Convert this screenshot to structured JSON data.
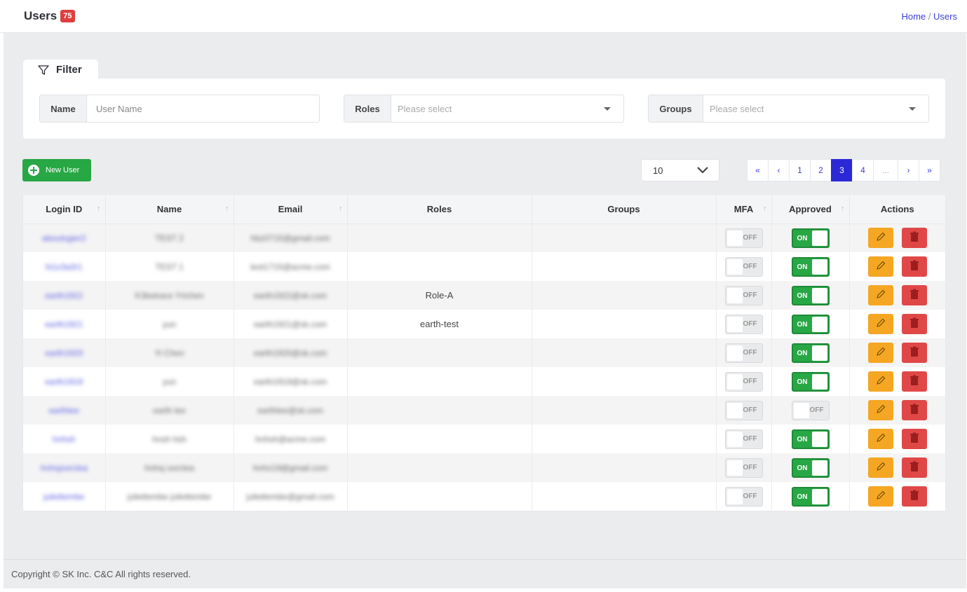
{
  "header": {
    "title": "Users",
    "count": "75",
    "breadcrumb": {
      "home": "Home",
      "separator": "/",
      "current": "Users"
    }
  },
  "filter": {
    "tab_label": "Filter",
    "name_label": "Name",
    "name_placeholder": "User Name",
    "roles_label": "Roles",
    "roles_placeholder": "Please select",
    "groups_label": "Groups",
    "groups_placeholder": "Please select"
  },
  "toolbar": {
    "new_user_label": "New User",
    "page_size": "10"
  },
  "pagination": {
    "first": "«",
    "prev": "‹",
    "pages": [
      "1",
      "2",
      "3",
      "4"
    ],
    "current_page": "3",
    "ellipsis": "...",
    "next": "›",
    "last": "»"
  },
  "table": {
    "columns": {
      "login_id": "Login ID",
      "name": "Name",
      "email": "Email",
      "roles": "Roles",
      "groups": "Groups",
      "mfa": "MFA",
      "approved": "Approved",
      "actions": "Actions"
    },
    "toggle_on_label": "ON",
    "toggle_off_label": "OFF",
    "rows": [
      {
        "login_id": "aboutsgier2",
        "name": "TEST 2",
        "email": "hbz0715@gmail.com",
        "roles": "",
        "groups": "",
        "mfa": false,
        "approved": true
      },
      {
        "login_id": "hi1x3a3r1",
        "name": "TEST 1",
        "email": "test1715@acme.com",
        "roles": "",
        "groups": "",
        "mfa": false,
        "approved": true
      },
      {
        "login_id": "earth1922",
        "name": "K3bstrace Yrichen",
        "email": "earth1922@sk.com",
        "roles": "Role-A",
        "groups": "",
        "mfa": false,
        "approved": true
      },
      {
        "login_id": "earth1921",
        "name": "yun",
        "email": "earth1921@sk.com",
        "roles": "earth-test",
        "groups": "",
        "mfa": false,
        "approved": true
      },
      {
        "login_id": "earth1920",
        "name": "Yi Chen",
        "email": "earth1920@sk.com",
        "roles": "",
        "groups": "",
        "mfa": false,
        "approved": true
      },
      {
        "login_id": "earth1919",
        "name": "yun",
        "email": "earth1919@sk.com",
        "roles": "",
        "groups": "",
        "mfa": false,
        "approved": true
      },
      {
        "login_id": "earthlee",
        "name": "earth lee",
        "email": "earthlee@sk.com",
        "roles": "",
        "groups": "",
        "mfa": false,
        "approved": false
      },
      {
        "login_id": "hnhsh",
        "name": "hnsh hsh",
        "email": "hnhsh@acme.com",
        "roles": "",
        "groups": "",
        "mfa": false,
        "approved": true
      },
      {
        "login_id": "hnhsjsorclea",
        "name": "hnhsj sorclea",
        "email": "hnhs19@gmail.com",
        "roles": "",
        "groups": "",
        "mfa": false,
        "approved": true
      },
      {
        "login_id": "juliettembe",
        "name": "juliettembe juliettembe",
        "email": "juliettembe@gmail.com",
        "roles": "",
        "groups": "",
        "mfa": false,
        "approved": true
      }
    ]
  },
  "footer": {
    "copyright": "Copyright © SK Inc. C&C All rights reserved."
  },
  "colors": {
    "accent": "#2b28d6",
    "success": "#28a745",
    "warning": "#f5a623",
    "danger": "#e04848",
    "badge": "#e03e3e"
  },
  "icons": [
    "filter-icon",
    "plus-circle-icon",
    "chevron-down-icon",
    "sort-arrow-icon",
    "pencil-icon",
    "trash-icon"
  ]
}
